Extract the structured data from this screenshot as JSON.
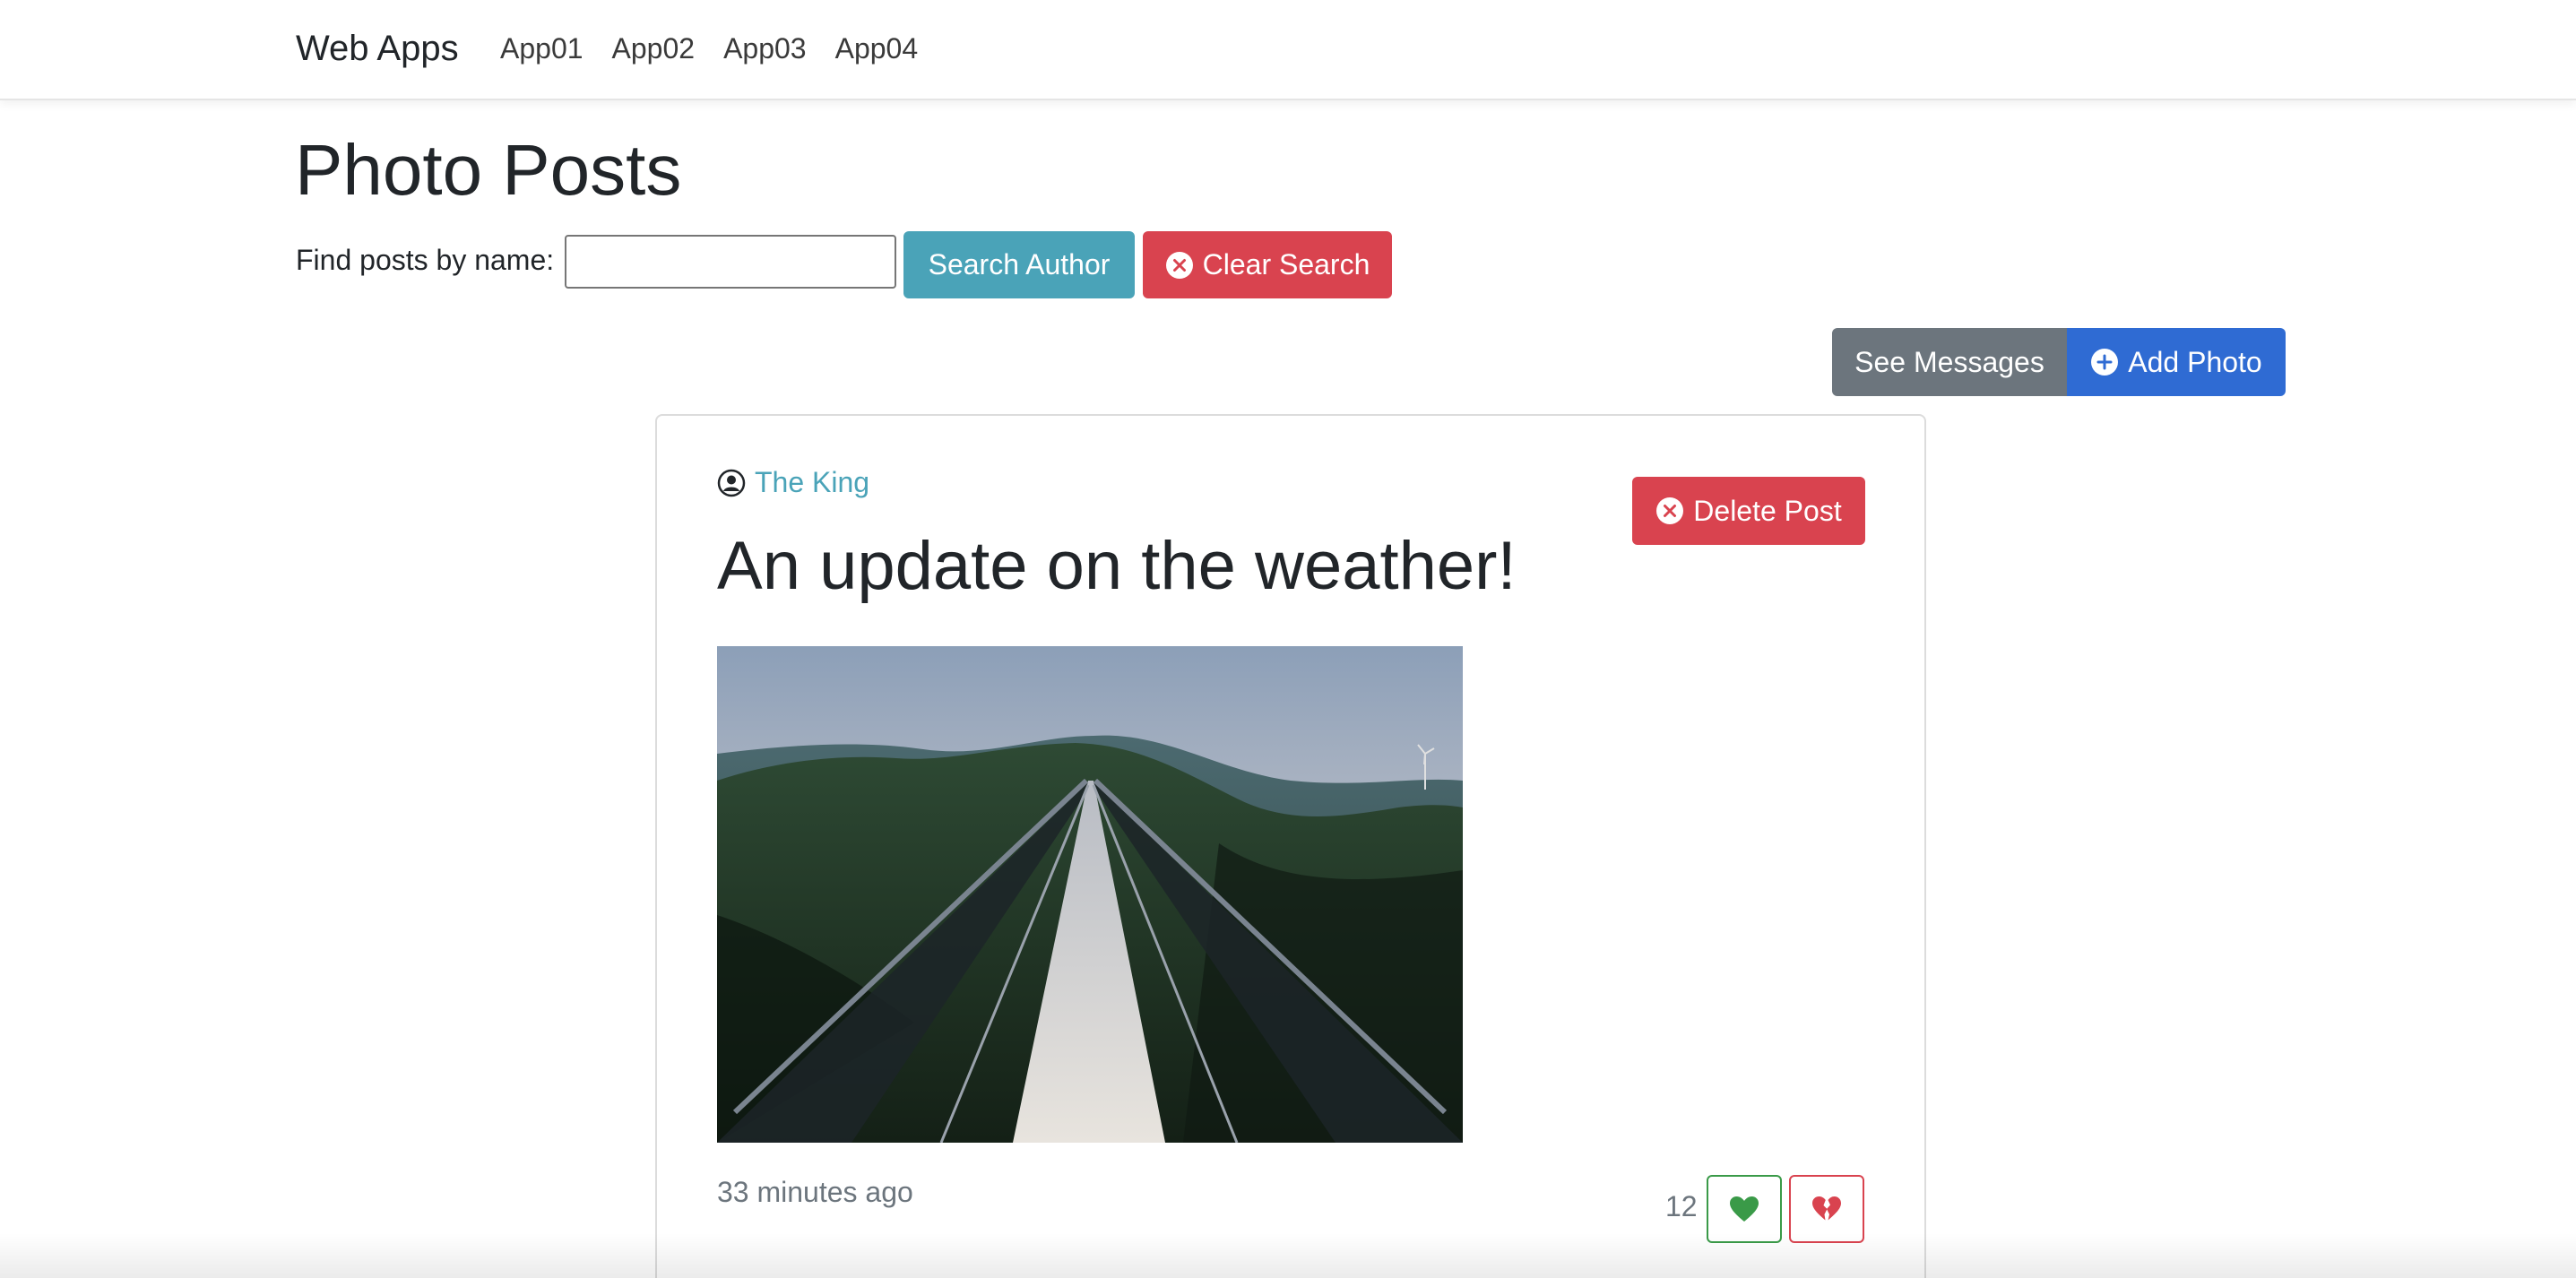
{
  "navbar": {
    "brand": "Web Apps",
    "links": [
      {
        "label": "App01"
      },
      {
        "label": "App02"
      },
      {
        "label": "App03"
      },
      {
        "label": "App04"
      }
    ]
  },
  "page": {
    "title": "Photo Posts"
  },
  "search": {
    "label": "Find posts by name:",
    "value": "",
    "placeholder": "",
    "search_button": "Search Author",
    "clear_button": "Clear Search"
  },
  "actions": {
    "see_messages": "See Messages",
    "add_photo": "Add Photo"
  },
  "post": {
    "author": "The King",
    "delete_button": "Delete Post",
    "title": "An update on the weather!",
    "timestamp": "33 minutes ago",
    "like_count": "12"
  },
  "colors": {
    "info": "#4aa3b8",
    "danger": "#d9434f",
    "secondary": "#6c757d",
    "primary": "#2f6bd3",
    "success": "#3a9a48"
  },
  "icons": {
    "clear": "x-circle-icon",
    "add": "plus-circle-icon",
    "author": "person-circle-icon",
    "delete": "x-circle-icon",
    "like": "heart-icon",
    "dislike": "broken-heart-icon"
  }
}
